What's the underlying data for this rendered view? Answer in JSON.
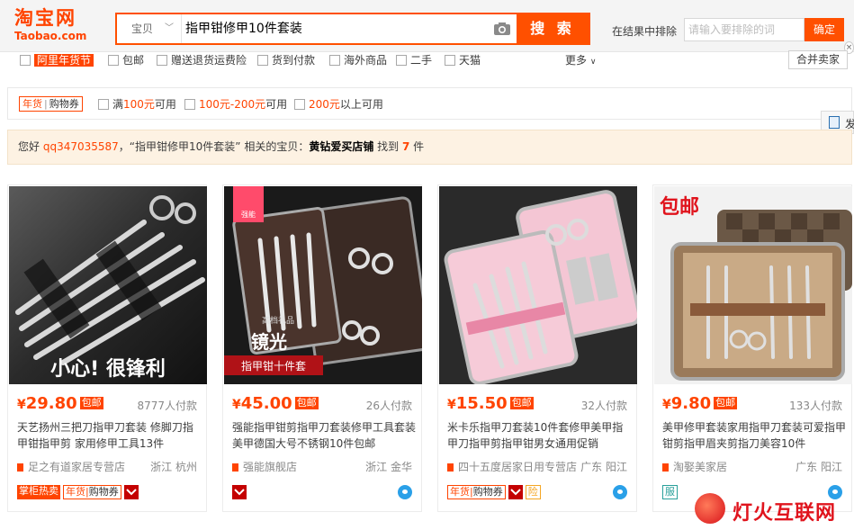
{
  "header": {
    "logo_cn": "淘宝网",
    "logo_en": "Taobao.com",
    "search_type": "宝贝",
    "search_query": "指甲钳修甲10件套装",
    "search_button": "搜 索",
    "exclude_label": "在结果中排除",
    "exclude_placeholder": "请输入要排除的词",
    "exclude_button": "确定"
  },
  "filters": {
    "items": [
      "阿里年货节",
      "包邮",
      "赠送退货运费险",
      "货到付款",
      "海外商品",
      "二手",
      "天猫"
    ],
    "more": "更多",
    "merge_sellers": "合并卖家"
  },
  "coupons": {
    "tag_left": "年货",
    "tag_right": "购物券",
    "items": [
      {
        "prefix": "满",
        "value": "100元",
        "suffix": "可用"
      },
      {
        "prefix": "",
        "value": "100元-200元",
        "suffix": "可用"
      },
      {
        "prefix": "",
        "value": "200元",
        "suffix": "以上可用"
      }
    ]
  },
  "share": {
    "label": "发"
  },
  "notice": {
    "greeting": "您好",
    "user": "qq347035587",
    "query_part": "，“指甲钳修甲10件套装” 相关的宝贝：",
    "shop": "黄钻爱买店铺",
    "found": " 找到 ",
    "count": "7",
    "unit": " 件"
  },
  "products": [
    {
      "yen": "¥",
      "price": "29.80",
      "baoyou": "包邮",
      "sales": "8777人付款",
      "title": "天艺扬州三把刀指甲刀套装 修脚刀指甲钳指甲剪 家用修甲工具13件",
      "shop": "足之有道家居专营店",
      "location": "浙江 杭州",
      "image_caption": "小心! 很锋利",
      "badges": [
        "掌柜热卖",
        "年货",
        "购物券"
      ]
    },
    {
      "yen": "¥",
      "price": "45.00",
      "baoyou": "包邮",
      "sales": "26人付款",
      "title": "强能指甲钳剪指甲刀套装修甲工具套装美甲德国大号不锈钢10件包邮",
      "shop": "强能旗舰店",
      "location": "浙江 金华",
      "image_caption_top": "高档礼品",
      "image_caption": "镜光",
      "image_caption_bottom": "指甲钳十件套",
      "image_brand": "强能"
    },
    {
      "yen": "¥",
      "price": "15.50",
      "baoyou": "包邮",
      "sales": "32人付款",
      "title": "米卡乐指甲刀套装10件套修甲美甲指甲刀指甲剪指甲钳男女通用促销",
      "shop": "四十五度居家日用专营店",
      "location": "广东 阳江",
      "badges": [
        "年货",
        "购物券",
        "险"
      ]
    },
    {
      "yen": "¥",
      "price": "9.80",
      "baoyou": "包邮",
      "sales": "133人付款",
      "title": "美甲修甲套装家用指甲刀套装可爱指甲钳剪指甲眉夹剪指刀美容10件",
      "shop": "淘娶美家居",
      "location": "广东 阳江",
      "image_caption": "包邮",
      "badges": [
        "服"
      ]
    }
  ],
  "watermark": {
    "text": "灯火互联网"
  },
  "colors": {
    "accent": "#ff5000",
    "price": "#ff4400",
    "notice_bg": "#fdf2e3"
  }
}
